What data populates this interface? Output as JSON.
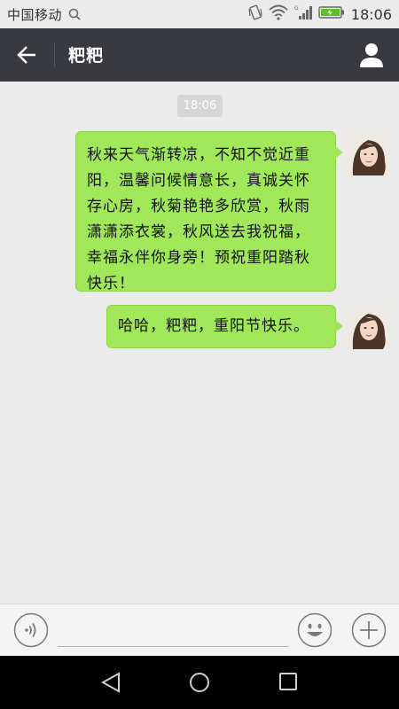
{
  "status_bar": {
    "carrier": "中国移动",
    "time": "18:06"
  },
  "header": {
    "title": "粑粑"
  },
  "chat": {
    "timestamp": "18:06",
    "messages": [
      {
        "text": "秋来天气渐转凉，不知不觉近重阳，温馨问候情意长，真诚关怀存心房，秋菊艳艳多欣赏，秋雨潇潇添衣裳，秋风送去我祝福，幸福永伴你身旁！预祝重阳踏秋快乐！"
      },
      {
        "text": "哈哈，粑粑，重阳节快乐。"
      }
    ]
  },
  "input_bar": {
    "placeholder": ""
  },
  "colors": {
    "header_bg": "#393a3f",
    "bubble_green": "#a0e75a",
    "chat_bg": "#ebebeb"
  },
  "icons": [
    "search-icon",
    "vibrate-icon",
    "wifi-icon",
    "signal-icon",
    "battery-icon",
    "back-arrow-icon",
    "profile-icon",
    "voice-icon",
    "emoji-icon",
    "plus-icon",
    "nav-back-icon",
    "nav-home-icon",
    "nav-recent-icon"
  ]
}
